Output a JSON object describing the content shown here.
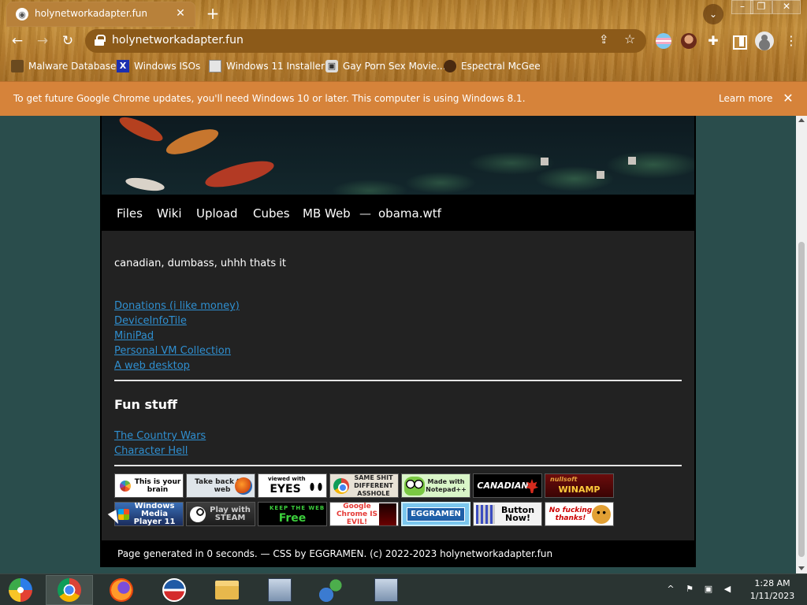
{
  "browser": {
    "tab_title": "holynetworkadapter.fun",
    "url": "holynetworkadapter.fun",
    "theme_color": "#b8813a"
  },
  "bookmarks": [
    {
      "label": "Malware Database"
    },
    {
      "label": "Windows ISOs"
    },
    {
      "label": "Windows 11 Installer"
    },
    {
      "label": "Gay Porn Sex Movie..."
    },
    {
      "label": "Espectral McGee"
    }
  ],
  "infobar": {
    "message": "To get future Google Chrome updates, you'll need Windows 10 or later. This computer is using Windows 8.1.",
    "learn_more": "Learn more"
  },
  "site": {
    "nav": [
      "Files",
      "Wiki",
      "Upload",
      "Cubes",
      "MB Web",
      "—",
      "obama.wtf"
    ],
    "tagline": "canadian, dumbass, uhhh thats it",
    "links": [
      "Donations (i like money)",
      "DeviceInfoTile",
      "MiniPad",
      "Personal VM Collection",
      "A web desktop"
    ],
    "fun_heading": "Fun stuff",
    "fun_links": [
      "The Country Wars",
      "Character Hell"
    ],
    "badges": [
      {
        "name": "brain",
        "text": "This is your brain"
      },
      {
        "name": "takeback",
        "text": "Take back the web"
      },
      {
        "name": "eyes",
        "text": "EYES"
      },
      {
        "name": "chrome",
        "text": "SAME SHIT DIFFERENT ASSHOLE"
      },
      {
        "name": "notepad",
        "text": "Made with Notepad++"
      },
      {
        "name": "canadian",
        "text": "CANADIAN"
      },
      {
        "name": "winamp",
        "text": "WINAMP"
      },
      {
        "name": "wmp",
        "text": "Windows Media Player 11"
      },
      {
        "name": "steam",
        "text": "Play with STEAM"
      },
      {
        "name": "keepfree",
        "text": "Free"
      },
      {
        "name": "evil",
        "text": "Google Chrome IS EVIL!"
      },
      {
        "name": "eggramen",
        "text": "EGGRAMEN"
      },
      {
        "name": "buttonnow",
        "text": "Button Now!"
      },
      {
        "name": "thanks",
        "text": "No fucking thanks!"
      }
    ],
    "footer": "Page generated in 0 seconds. — CSS by EGGRAMEN. (c) 2022-2023 holynetworkadapter.fun",
    "link_color": "#2f8fd0"
  },
  "taskbar": {
    "clock_time": "1:28 AM",
    "clock_date": "1/11/2023"
  }
}
